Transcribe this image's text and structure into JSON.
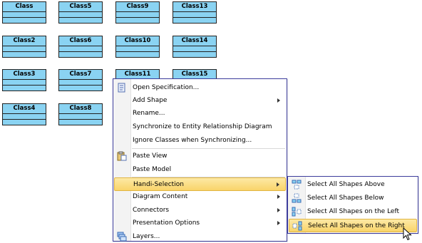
{
  "diagram": {
    "classes": [
      "Class",
      "Class5",
      "Class9",
      "Class13",
      "Class2",
      "Class6",
      "Class10",
      "Class14",
      "Class3",
      "Class7",
      "Class11",
      "Class15",
      "Class4",
      "Class8"
    ]
  },
  "context_menu": {
    "items": [
      {
        "label": "Open Specification...",
        "icon": "specification-icon"
      },
      {
        "label": "Add Shape",
        "submenu": true
      },
      {
        "label": "Rename..."
      },
      {
        "label": "Synchronize to Entity Relationship Diagram"
      },
      {
        "label": "Ignore Classes when Synchronizing..."
      },
      {
        "label": "Paste View",
        "icon": "paste-icon"
      },
      {
        "label": "Paste Model"
      },
      {
        "label": "Handi-Selection",
        "submenu": true,
        "highlighted": true
      },
      {
        "label": "Diagram Content",
        "submenu": true
      },
      {
        "label": "Connectors",
        "submenu": true
      },
      {
        "label": "Presentation Options",
        "submenu": true
      },
      {
        "label": "Layers...",
        "icon": "layers-icon"
      }
    ]
  },
  "submenu": {
    "items": [
      {
        "label": "Select All Shapes Above",
        "icon": "select-above-icon"
      },
      {
        "label": "Select All Shapes Below",
        "icon": "select-below-icon"
      },
      {
        "label": "Select All Shapes on the Left",
        "icon": "select-left-icon"
      },
      {
        "label": "Select All Shapes on the Right",
        "icon": "select-right-icon",
        "highlighted": true
      }
    ]
  },
  "colors": {
    "class_fill": "#8ad3f2",
    "menu_border": "#3c3c9c",
    "highlight_top": "#fde9a5",
    "highlight_bottom": "#f9d46a"
  }
}
